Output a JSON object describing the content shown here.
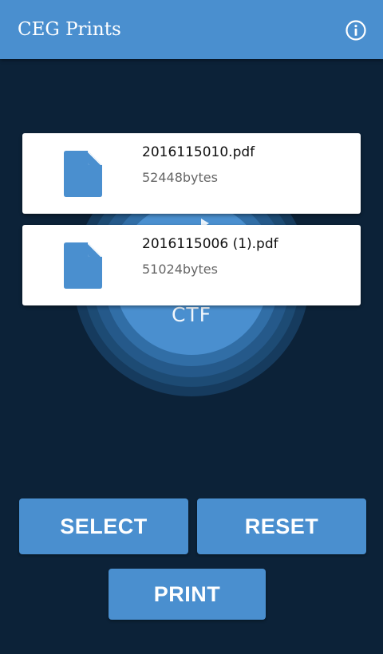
{
  "app_bar": {
    "title": "CEG Prints",
    "info_icon": "info-icon"
  },
  "center_button": {
    "label": "CTF"
  },
  "files": [
    {
      "name": "2016115010.pdf",
      "size": "52448bytes",
      "icon": "document-icon"
    },
    {
      "name": "2016115006 (1).pdf",
      "size": "51024bytes",
      "icon": "document-icon"
    }
  ],
  "actions": {
    "select_label": "SELECT",
    "reset_label": "RESET",
    "print_label": "PRINT"
  },
  "colors": {
    "primary": "#4a8fcf",
    "background": "#0c2238",
    "card": "#ffffff"
  }
}
